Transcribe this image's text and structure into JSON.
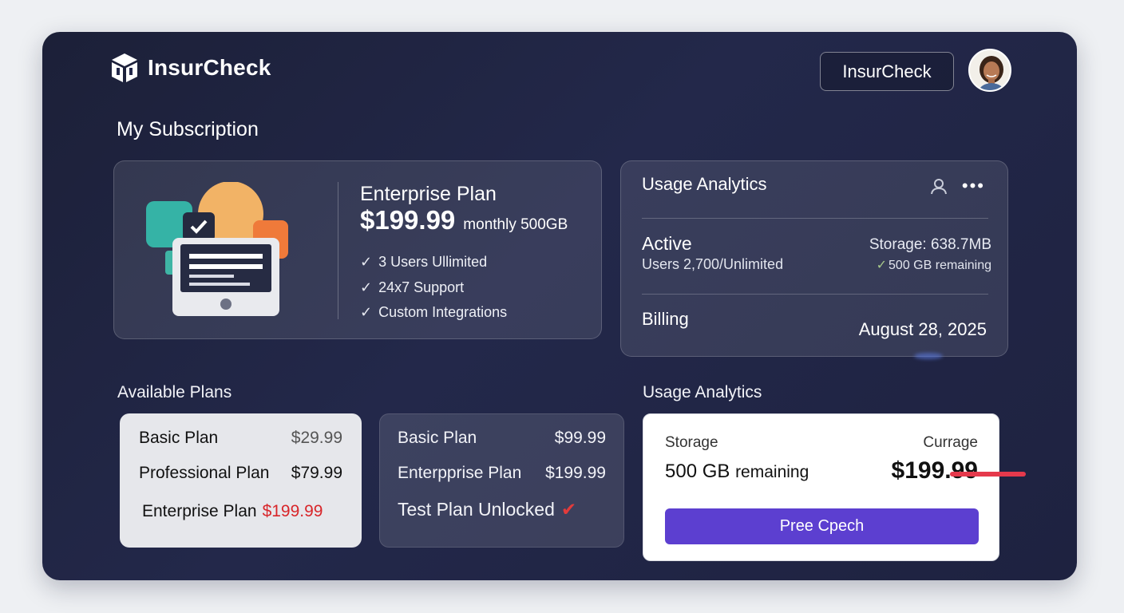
{
  "header": {
    "logo_text": "InsurCheck",
    "button_label": "InsurCheck",
    "avatar_alt": "user avatar"
  },
  "subscription": {
    "section_title": "My Subscription",
    "plan_name": "Enterprise Plan",
    "price": "$199.99",
    "price_suffix": "monthly 500GB",
    "features": [
      "3 Users Ullimited",
      "24x7 Support",
      "Custom Integrations"
    ]
  },
  "usage": {
    "title": "Usage Analytics",
    "active_label": "Active",
    "active_users": "Users 2,700/Unlimited",
    "storage_used": "Storage: 638.7MB",
    "storage_remaining": "500 GB remaining",
    "billing_label": "Billing",
    "billing_date": "August 28, 2025"
  },
  "available_plans": {
    "section_title": "Available Plans",
    "light_card": [
      {
        "name": "Basic Plan",
        "price": "$29.99"
      },
      {
        "name": "Professional Plan",
        "price": "$79.99"
      },
      {
        "name": "Enterprise Plan",
        "price": "$199.99"
      }
    ],
    "dark_card": [
      {
        "name": "Basic Plan",
        "price": "$99.99"
      },
      {
        "name": "Enterpprise Plan",
        "price": "$199.99"
      },
      {
        "name": "Test Plan Unlocked",
        "price": ""
      }
    ]
  },
  "usage_summary": {
    "section_title": "Usage Analytics",
    "storage_label": "Storage",
    "currage_label": "Currage",
    "remaining_value": "500 GB",
    "remaining_word": "remaining",
    "price": "$199.99",
    "cta_label": "Pree Cpech"
  },
  "colors": {
    "accent": "#5c3fd0",
    "background": "#1c2038",
    "danger": "#d8262a"
  }
}
